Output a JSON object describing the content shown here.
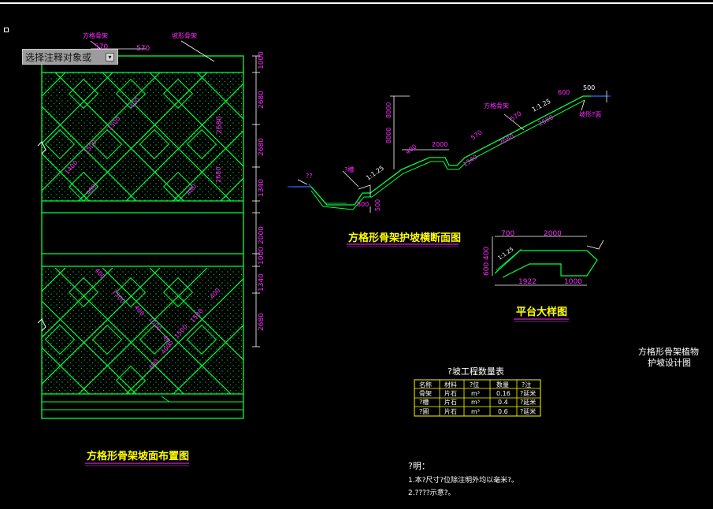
{
  "colors": {
    "bg": "#000000",
    "green": "#00ff3c",
    "magenta": "#ff2cff",
    "white": "#ffffff",
    "cyan": "#00e0ff",
    "blue": "#2a4cff"
  },
  "prompt": {
    "text": "选择注释对象或",
    "icon": "menu-arrow-icon"
  },
  "left": {
    "top_labels": [
      "方格骨架",
      "坡形骨架"
    ],
    "top_dims": [
      "570",
      "570"
    ],
    "right_dims": [
      "1000",
      "2680",
      "2680",
      "2680",
      "1340",
      "2000",
      "1000",
      "1340",
      "2680"
    ],
    "inner_dims_top": [
      "1400",
      "1500",
      "1500",
      "400",
      "2680",
      "2680",
      "480",
      "480"
    ],
    "inner_dims_bottom": [
      "400",
      "1500",
      "400",
      "1500",
      "400",
      "400",
      "1500",
      "1500",
      "400",
      "400"
    ],
    "title": "方格形骨架坡面布置图"
  },
  "section": {
    "labels": [
      "??",
      "?槽",
      "方格骨架",
      "坡形?面"
    ],
    "dims": [
      "8000",
      "8000",
      "1:1.25",
      "800",
      "500",
      "400",
      "2000",
      "570",
      "570",
      "1340",
      "2680",
      "2680",
      "1:1.25",
      "600",
      "500"
    ],
    "title": "方格形骨架护坡横断面图"
  },
  "platform": {
    "dims": [
      "700",
      "2000",
      "400",
      "600",
      "1:1.25",
      "1922",
      "1000"
    ],
    "title": "平台大样图"
  },
  "side_title": [
    "方格形骨架植物",
    "护坡设计图"
  ],
  "table": {
    "title": "?坡工程数量表",
    "headers": [
      "名称",
      "材料",
      "?位",
      "数量",
      "?注"
    ],
    "rows": [
      [
        "骨架",
        "片石",
        "m³",
        "0.16",
        "?延米"
      ],
      [
        "?槽",
        "片石",
        "m³",
        "0.4",
        "?延米"
      ],
      [
        "?圃",
        "片石",
        "m³",
        "0.6",
        "?延米"
      ]
    ]
  },
  "notes": {
    "title": "?明：",
    "lines": [
      "1.本?尺寸?位除注明外均以毫米?。",
      "2.????示意?。"
    ]
  }
}
